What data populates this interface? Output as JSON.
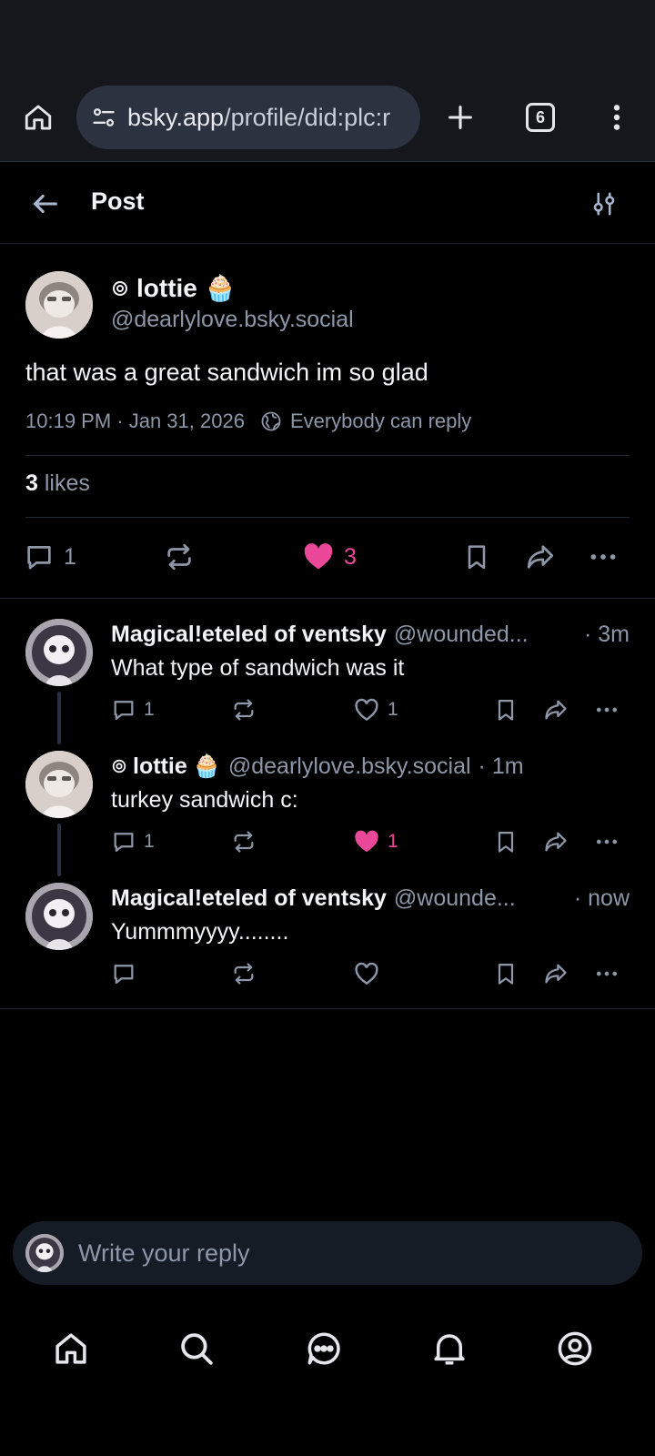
{
  "browser": {
    "url_host": "bsky.app",
    "url_path": "/profile/did:plc:r",
    "tab_count": "6"
  },
  "header": {
    "title": "Post"
  },
  "main_post": {
    "author_name": "lottie",
    "author_emoji": "🧁",
    "author_handle": "@dearlylove.bsky.social",
    "text": "that was a great sandwich im so glad",
    "timestamp": "10:19 PM · Jan 31, 2026",
    "reply_setting": "Everybody can reply",
    "likes_count": "3",
    "likes_label": "likes",
    "reply_count": "1",
    "like_count": "3"
  },
  "replies": [
    {
      "name": "Magical!eteled of ventsky",
      "handle": "@wounded...",
      "time": "· 3m",
      "text": "What type of sandwich was it",
      "reply_count": "1",
      "like_count": "1",
      "liked": false
    },
    {
      "name": "lottie",
      "emoji": "🧁",
      "handle": "@dearlylove.bsky.social",
      "time": "· 1m",
      "text": "turkey sandwich c:",
      "reply_count": "1",
      "like_count": "1",
      "liked": true
    },
    {
      "name": "Magical!eteled of ventsky",
      "handle": "@wounde...",
      "time": "· now",
      "text": "Yummmyyyy........",
      "reply_count": "",
      "like_count": "",
      "liked": false
    }
  ],
  "composer": {
    "placeholder": "Write your reply"
  },
  "icons": {
    "browser": [
      "home-icon",
      "site-settings-icon",
      "new-tab-icon",
      "tab-switcher-icon",
      "more-vert-icon"
    ],
    "header": [
      "back-arrow-icon",
      "thread-options-icon"
    ],
    "actions": [
      "reply-icon",
      "repost-icon",
      "like-icon",
      "bookmark-icon",
      "share-icon",
      "more-horizontal-icon"
    ],
    "nav": [
      "home-icon",
      "search-icon",
      "chat-icon",
      "notifications-icon",
      "profile-icon"
    ]
  },
  "colors": {
    "accent_like": "#ec4899",
    "muted_text": "#8d97a8",
    "background": "#000000",
    "browser_bar": "#15171c"
  }
}
